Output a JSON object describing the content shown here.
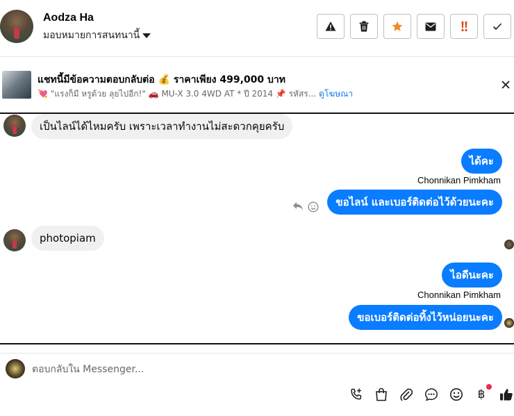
{
  "header": {
    "name": "Aodza Ha",
    "assign_label": "มอบหมายการสนทนานี้",
    "actions": [
      {
        "icon": "warning-icon"
      },
      {
        "icon": "trash-icon"
      },
      {
        "icon": "star-icon"
      },
      {
        "icon": "mail-icon"
      },
      {
        "icon": "urgent-icon"
      },
      {
        "icon": "check-icon"
      }
    ]
  },
  "banner": {
    "title": "แชทนี้มีข้อความตอบกลับต่อ 💰 ราคาเพียง 499,000 บาท",
    "subtitle": "💘 \"แรงก็มี หรูด้วย ลุยไปอีก!\" 🚗 MU-X 3.0 4WD AT * ปี 2014 📌 รหัสร...",
    "link": "ดูโฆษณา"
  },
  "messages": {
    "m1": "เป็นไลน์ได้ไหมครับ เพราะเวลาทำงานไม่สะดวกคุยครับ",
    "m2": "ได้คะ",
    "m2_sender": "Chonnikan Pimkham",
    "m3": "ขอไลน์ และเบอร์ติดต่อไว้ด้วยนะคะ",
    "m4": "photopiam",
    "m5": "ไอดีนะคะ",
    "m5_sender": "Chonnikan Pimkham",
    "m6": "ขอเบอร์ติดต่อทิ้งไว้หน่อยนะคะ"
  },
  "composer": {
    "placeholder": "ตอบกลับใน Messenger...",
    "baht_symbol": "฿"
  },
  "colors": {
    "outgoing_bubble": "#0a7cff",
    "incoming_bubble": "#f0f0f0",
    "link": "#1877f2",
    "star": "#f28b22",
    "urgent": "#e0401c"
  }
}
